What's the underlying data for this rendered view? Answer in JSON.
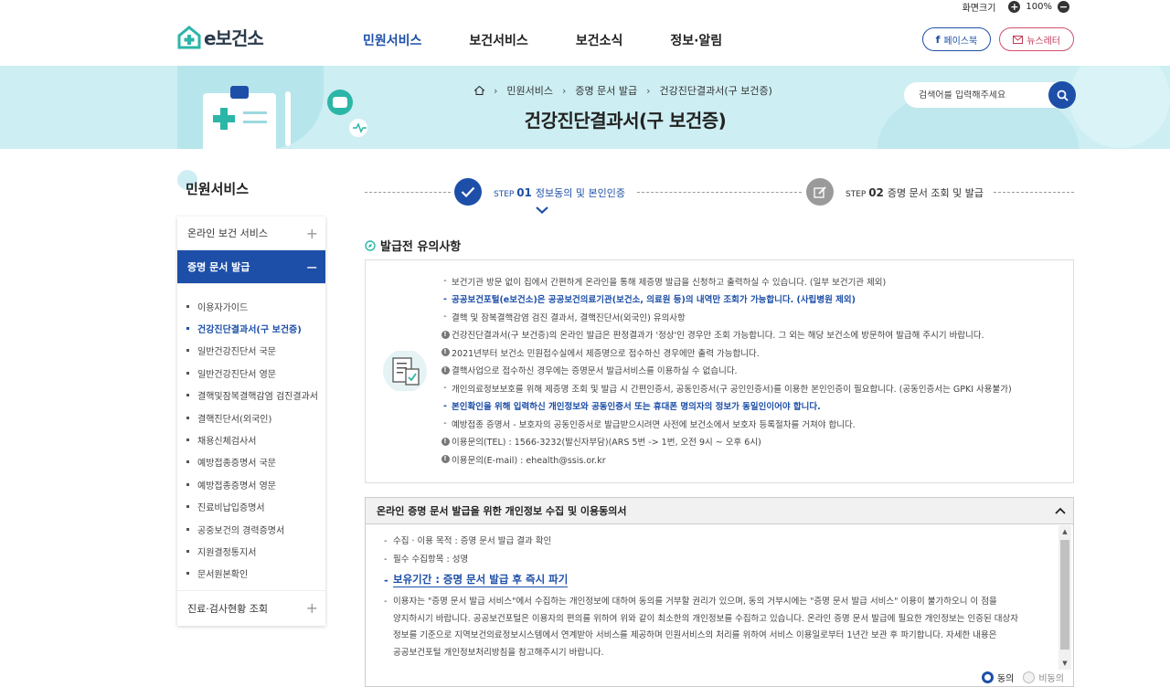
{
  "zoom": {
    "label": "화면크기",
    "value": "100%"
  },
  "logo": {
    "text": "e보건소"
  },
  "gnb": [
    "민원서비스",
    "보건서비스",
    "보건소식",
    "정보·알림"
  ],
  "sns": {
    "facebook": "페이스북",
    "newsletter": "뉴스레터"
  },
  "breadcrumb": [
    "민원서비스",
    "증명 문서 발급",
    "건강진단결과서(구 보건증)"
  ],
  "page_title": "건강진단결과서(구 보건증)",
  "search": {
    "placeholder": "검색어를 입력해주세요"
  },
  "sidebar": {
    "title": "민원서비스",
    "menu1": "온라인 보건 서비스",
    "menu2": "증명 문서 발급",
    "menu3": "진료·검사현황 조회",
    "sub": [
      "이용자가이드",
      "건강진단결과서(구 보건증)",
      "일반건강진단서 국문",
      "일반건강진단서 영문",
      "결핵및잠복결핵감염 검진결과서",
      "결핵진단서(외국인)",
      "채용신체검사서",
      "예방접종증명서 국문",
      "예방접종증명서 영문",
      "진료비납입증명서",
      "공중보건의 경력증명서",
      "지원결정통지서",
      "문서원본확인"
    ]
  },
  "steps": {
    "step1": {
      "prefix": "STEP",
      "num": "01",
      "label": "정보동의 및 본인인증"
    },
    "step2": {
      "prefix": "STEP",
      "num": "02",
      "label": "증명 문서 조회 및 발급"
    }
  },
  "notice": {
    "title": "발급전 유의사항",
    "items": [
      "보건기관 방문 없이 집에서 간편하게 온라인을 통해 제증명 발급을 신청하고 출력하실 수 있습니다. (일부 보건기관 제외)",
      "공공보건포털(e보건소)은 공공보건의료기관(보건소, 의료원 등)의 내역만 조회가 가능합니다. (사립병원 제외)",
      "결핵 및 잠복결핵감염 검진 결과서, 결핵진단서(외국인) 유의사항",
      "건강진단결과서(구 보건증)의 온라인 발급은 판정결과가 '정상'인 경우만 조회 가능합니다. 그 외는 해당 보건소에 방문하여 발급해 주시기 바랍니다.",
      "2021년부터 보건소 민원접수실에서 제증명으로 접수하신 경우에만 출력 가능합니다.",
      "결핵사업으로 접수하신 경우에는 증명문서 발급서비스를 이용하실 수 없습니다.",
      "개인의료정보보호를 위해 제증명 조회 및 발급 시 간편인증서, 공동인증서(구 공인인증서)를 이용한 본인인증이 필요합니다. (공동인증서는 GPKI 사용불가)",
      "본인확인을 위해 입력하신 개인정보와 공동인증서 또는 휴대폰 명의자의 정보가 동일인이어야 합니다.",
      "예방접종 증명서 - 보호자의 공동인증서로 발급받으시려면 사전에 보건소에서 보호자 등록절차를 거쳐야 합니다.",
      "이용문의(TEL) : 1566-3232(발신자부담)(ARS 5번 -> 1번, 오전 9시 ~ 오후 6시)",
      "이용문의(E-mail) : ehealth@ssis.or.kr"
    ]
  },
  "consent": {
    "title": "온라인 증명 문서 발급을 위한 개인정보 수집 및 이용동의서",
    "purpose": "수집 · 이용 목적 : 증명 문서 발급 결과 확인",
    "fields": "필수 수집항목 : 성명",
    "retention": "보유기간 : 증명 문서 발급 후 즉시 파기",
    "para1": "이용자는 \"증명 문서 발급 서비스\"에서 수집하는 개인정보에 대하여 동의를 거부할 권리가 있으며, 동의 거부시에는 \"증명 문서 발급 서비스\" 이용이 불가하오니 이 점을",
    "para2": "양지하시기 바랍니다. 공공보건포털은 이용자의 편의를 위하여 위와 같이 최소한의 개인정보를 수집하고 있습니다. 온라인 증명 문서 발급에 필요한 개인정보는 인증된 대상자",
    "para3": "정보를 기준으로 지역보건의료정보시스템에서 연계받아 서비스를 제공하며 민원서비스의 처리를 위하여 서비스 이용일로부터 1년간 보관 후 파기합니다. 자세한 내용은",
    "para4": "공공보건포털 개인정보처리방침을 참고해주시기 바랍니다.",
    "agree": "동의",
    "disagree": "비동의"
  },
  "colors": {
    "primary": "#1d4fa8",
    "banner": "#cdeef2"
  }
}
